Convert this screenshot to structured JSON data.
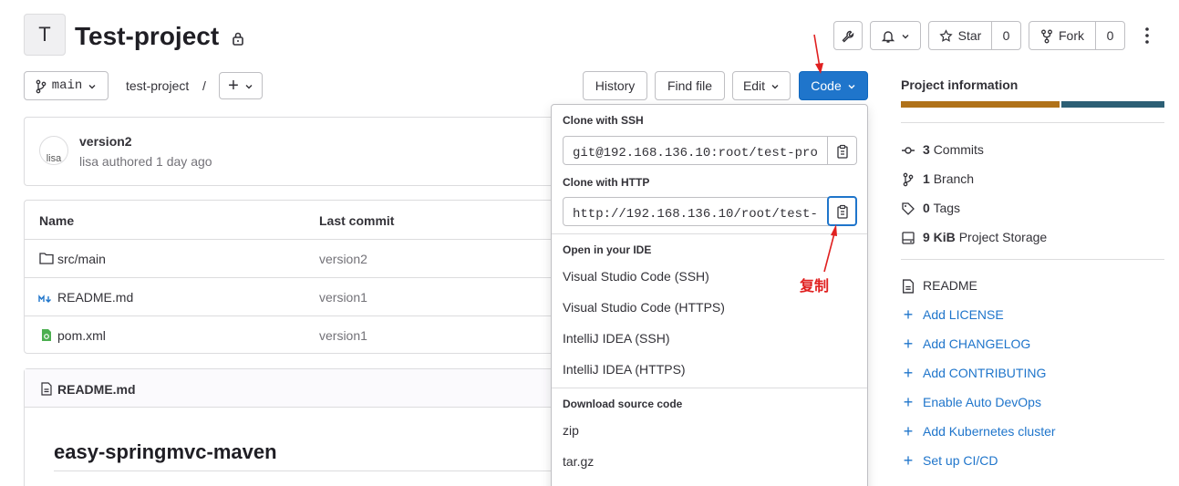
{
  "project": {
    "avatar_letter": "T",
    "title": "Test-project"
  },
  "header_actions": {
    "star_label": "Star",
    "star_count": "0",
    "fork_label": "Fork",
    "fork_count": "0"
  },
  "repo_bar": {
    "branch": "main",
    "path": "test-project",
    "path_sep": "/",
    "history": "History",
    "find_file": "Find file",
    "edit": "Edit",
    "code": "Code"
  },
  "commit": {
    "avatar_alt": "lisa",
    "message": "version2",
    "meta": "lisa authored 1 day ago"
  },
  "files": {
    "col_name": "Name",
    "col_commit": "Last commit",
    "rows": [
      {
        "name": "src/main",
        "commit": "version2",
        "icon": "folder-icon"
      },
      {
        "name": "README.md",
        "commit": "version1",
        "icon": "markdown-icon"
      },
      {
        "name": "pom.xml",
        "commit": "version1",
        "icon": "xml-file-icon"
      }
    ]
  },
  "readme": {
    "header": "README.md",
    "heading": "easy-springmvc-maven"
  },
  "dropdown": {
    "ssh_label": "Clone with SSH",
    "ssh_url": "git@192.168.136.10:root/test-pro",
    "http_label": "Clone with HTTP",
    "http_url": "http://192.168.136.10/root/test-",
    "ide_label": "Open in your IDE",
    "ide_items": [
      "Visual Studio Code (SSH)",
      "Visual Studio Code (HTTPS)",
      "IntelliJ IDEA (SSH)",
      "IntelliJ IDEA (HTTPS)"
    ],
    "download_label": "Download source code",
    "download_items": [
      "zip",
      "tar.gz"
    ]
  },
  "annotation": {
    "copy_note": "复制",
    "color": "#e02020"
  },
  "sidebar": {
    "title": "Project information",
    "commits_count": "3",
    "commits_label": "Commits",
    "branch_count": "1",
    "branch_label": "Branch",
    "tags_count": "0",
    "tags_label": "Tags",
    "storage_size": "9 KiB",
    "storage_label": "Project Storage",
    "readme": "README",
    "links": [
      "Add LICENSE",
      "Add CHANGELOG",
      "Add CONTRIBUTING",
      "Enable Auto DevOps",
      "Add Kubernetes cluster",
      "Set up CI/CD"
    ]
  },
  "colors": {
    "primary": "#1f75cb",
    "lang_bar_1": "#b07219",
    "lang_bar_2": "#2c5f75"
  }
}
